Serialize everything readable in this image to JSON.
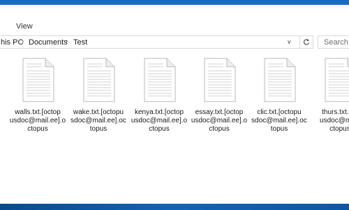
{
  "ribbon": {
    "tabs": [
      {
        "label": "View"
      }
    ]
  },
  "address_bar": {
    "crumbs": [
      "his PC",
      "Documents",
      "Test"
    ]
  },
  "search": {
    "placeholder": "Search Te"
  },
  "files": [
    {
      "name": "walls.txt.[octop usdoc@mail.ee].o ctopus",
      "line1": "walls.txt.[octop",
      "line2": "usdoc@mail.ee].o",
      "line3": "ctopus"
    },
    {
      "name": "wake.txt.[octopu sdoc@mail.ee].oc topus",
      "line1": "wake.txt.[octopu",
      "line2": "sdoc@mail.ee].oc",
      "line3": "topus"
    },
    {
      "name": "kenya.txt.[octop usdoc@mail.ee].o ctopus",
      "line1": "kenya.txt.[octop",
      "line2": "usdoc@mail.ee].o",
      "line3": "ctopus"
    },
    {
      "name": "essay.txt.[octop usdoc@mail.ee].o ctopus",
      "line1": "essay.txt.[octop",
      "line2": "usdoc@mail.ee].o",
      "line3": "ctopus"
    },
    {
      "name": "clic.txt.[octopu sdoc@mail.ee].oc topus",
      "line1": "clic.txt.[octopu",
      "line2": "sdoc@mail.ee].oc",
      "line3": "topus"
    },
    {
      "name": "thurs.txt.[octop usdoc@mail.ee].o ctopus",
      "line1": "thurs.txt.[oc",
      "line2": "usdoc@mail.",
      "line3": "ctopus"
    }
  ],
  "colors": {
    "title_accent": "#1a6fc4",
    "taskbar": "#0d58a4"
  }
}
